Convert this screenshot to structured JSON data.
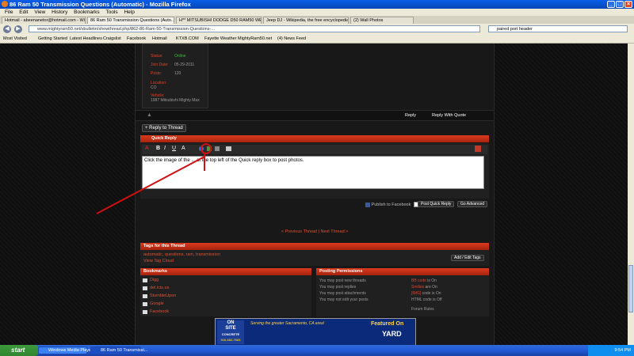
{
  "window": {
    "title": "86 Ram 50 Transmission Questions (Automatic) - Mozilla Firefox"
  },
  "menu": [
    "File",
    "Edit",
    "View",
    "History",
    "Bookmarks",
    "Tools",
    "Help"
  ],
  "tabs": [
    "Hotmail - abeenanetor@hotmail.com - Wi...",
    "86 Ram 50 Transmission Questions (Auto...",
    "H** MITSUBISHI DODGE D50 RAM50 WEBER ...",
    "Jeep DJ - Wikipedia, the free encyclopedia",
    "(2) Wall Photos"
  ],
  "nav": {
    "url": "www.mightyram50.net/vbulletin/showthread.php/862-86-Ram-50-Transmission-Questions-...",
    "search": "paired port header"
  },
  "bookmarks": [
    "Most Visited",
    "Getting Started",
    "Latest Headlines",
    "Craigslist",
    "Facebook",
    "Hotmail",
    "KTXB.COM",
    "Fayette Weather",
    "MightyRam50.net",
    "(4) News Feed"
  ],
  "profile": {
    "rows": [
      {
        "label": "Status:",
        "value": "Online"
      },
      {
        "label": "Join Date:",
        "value": "05-29-2011"
      },
      {
        "label": "Posts:",
        "value": "120"
      }
    ],
    "location_label": "Location:",
    "location_value": "CO",
    "vehicle_label": "Vehicle:",
    "vehicle_value": "1987 Mitsubishi Mighty Max"
  },
  "post_actions": {
    "reply": "Reply",
    "reply_quote": "Reply With Quote"
  },
  "reply_thread": "+ Reply to Thread",
  "quick_reply": {
    "header": "Quick Reply",
    "text": "Click the image of the ... at the top left of the Quick reply box to post photos.",
    "publish": "Publish to Facebook",
    "post_button": "Post Quick Reply",
    "advanced_button": "Go Advanced"
  },
  "thread_nav": "< Previous Thread | Next Thread >",
  "tags": {
    "header": "Tags for this Thread",
    "list": "automatic, questions, ram, transmission",
    "cloud": "View Tag Cloud",
    "edit_button": "Add / Edit Tags"
  },
  "bookmarks_box": {
    "header": "Bookmarks",
    "items": [
      "Digg",
      "del.icio.us",
      "StumbleUpon",
      "Google",
      "Facebook"
    ]
  },
  "permissions": {
    "header": "Posting Permissions",
    "left": [
      "You may post new threads",
      "You may post replies",
      "You may post attachments",
      "You may not edit your posts"
    ],
    "right": [
      {
        "key": "BB code",
        "rest": " is On"
      },
      {
        "key": "Smilies",
        "rest": " are On"
      },
      {
        "key": "[IMG]",
        "rest": " code is On"
      },
      {
        "key": "",
        "rest": "HTML code is Off"
      }
    ],
    "rules": "Forum Rules"
  },
  "ad": {
    "brand_line1": "ON",
    "brand_line2": "SITE",
    "brand_line3": "CONCRETE",
    "phone": "916-682-7683",
    "slogan": "Serving the greater Sacramento, CA area!",
    "featured": "Featured On",
    "show": "YARD"
  },
  "taskbar": {
    "start": "start",
    "tasks": [
      "Windows Media Player",
      "86 Ram 50 Transmissi..."
    ],
    "time": "9:54 PM"
  },
  "colors": {
    "accent": "#e0412a",
    "titlebar": "#0a5ee8",
    "annotation": "#d01010"
  }
}
